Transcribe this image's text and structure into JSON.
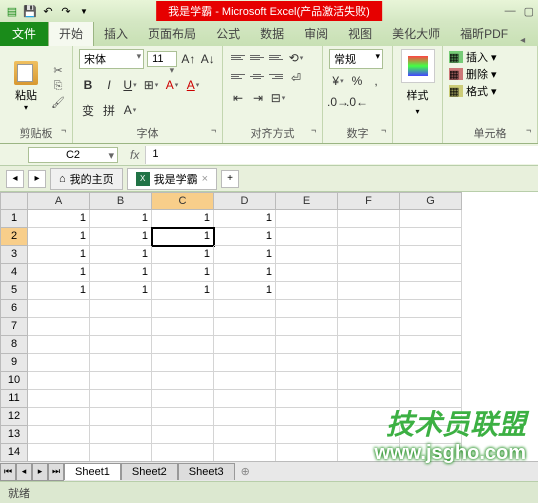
{
  "title": "我是学霸 - Microsoft Excel(产品激活失败)",
  "tabs": {
    "file": "文件",
    "items": [
      "开始",
      "插入",
      "页面布局",
      "公式",
      "数据",
      "审阅",
      "视图",
      "美化大师",
      "福昕PDF"
    ],
    "active": 0
  },
  "ribbon": {
    "clipboard": {
      "label": "剪贴板",
      "paste": "粘贴"
    },
    "font": {
      "label": "字体",
      "name": "宋体",
      "size": "11"
    },
    "align": {
      "label": "对齐方式"
    },
    "number": {
      "label": "数字",
      "format": "常规"
    },
    "styles": {
      "label": "样式",
      "btn": "样式"
    },
    "cells": {
      "label": "单元格",
      "insert": "插入",
      "delete": "删除",
      "format": "格式"
    }
  },
  "namebox": "C2",
  "formula": "1",
  "doc_tabs": {
    "home": "我的主页",
    "active": "我是学霸"
  },
  "columns": [
    "A",
    "B",
    "C",
    "D",
    "E",
    "F",
    "G"
  ],
  "sel_col": 2,
  "sel_row": 1,
  "row_count": 14,
  "data": [
    [
      "1",
      "1",
      "1",
      "1",
      "",
      "",
      ""
    ],
    [
      "1",
      "1",
      "1",
      "1",
      "",
      "",
      ""
    ],
    [
      "1",
      "1",
      "1",
      "1",
      "",
      "",
      ""
    ],
    [
      "1",
      "1",
      "1",
      "1",
      "",
      "",
      ""
    ],
    [
      "1",
      "1",
      "1",
      "1",
      "",
      "",
      ""
    ]
  ],
  "sheets": [
    "Sheet1",
    "Sheet2",
    "Sheet3"
  ],
  "status": "就绪",
  "watermark1": "技术员联盟",
  "watermark2": "www.jsgho.com"
}
